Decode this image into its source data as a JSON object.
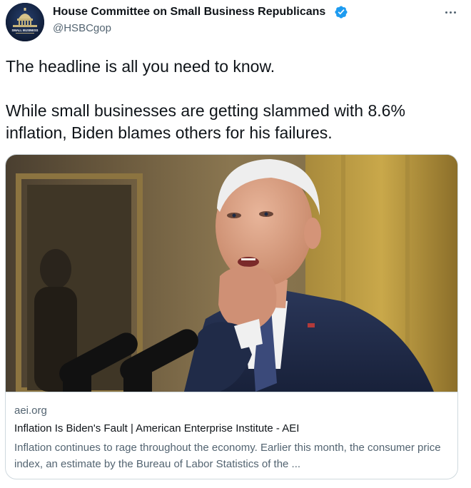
{
  "author": {
    "name": "House Committee on Small Business Republicans",
    "handle": "@HSBCgop",
    "verified": true,
    "avatar_text": "SMALL BUSINESS"
  },
  "more_icon": "more-horizontal-icon",
  "verified_icon": "verified-badge-icon",
  "tweet": {
    "paragraph1": "The headline is all you need to know.",
    "paragraph2": "While small businesses are getting slammed with 8.6% inflation, Biden blames others for his failures."
  },
  "card": {
    "domain": "aei.org",
    "title": "Inflation Is Biden's Fault | American Enterprise Institute - AEI",
    "description": "Inflation continues to rage throughout the economy. Earlier this month, the consumer price index, an estimate by the Bureau of Labor Statistics of the ..."
  },
  "colors": {
    "verified_blue": "#1d9bf0",
    "secondary_text": "#536471",
    "primary_text": "#0f1419",
    "border": "#cfd9de"
  }
}
